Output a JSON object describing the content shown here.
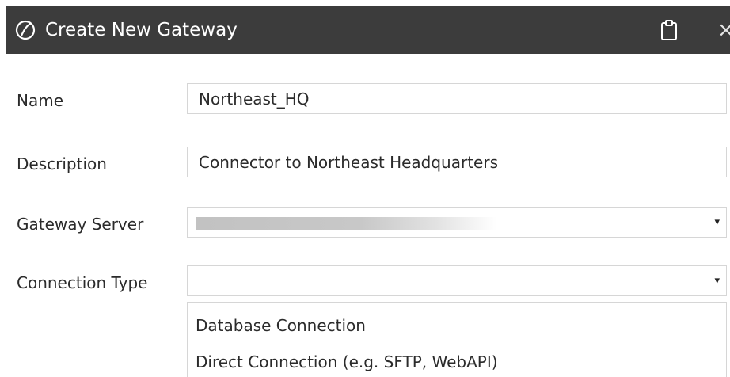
{
  "dialog": {
    "title": "Create New Gateway",
    "logo_icon": "circle-slash-logo-icon",
    "clipboard_icon": "clipboard-icon",
    "close_label": "×"
  },
  "form": {
    "name": {
      "label": "Name",
      "value": "Northeast_HQ"
    },
    "description": {
      "label": "Description",
      "value": "Connector to Northeast Headquarters"
    },
    "gateway_server": {
      "label": "Gateway Server",
      "value_redacted": true,
      "arrow": "▾"
    },
    "connection_type": {
      "label": "Connection Type",
      "value": "",
      "arrow": "▾",
      "options": [
        "Database Connection",
        "Direct Connection (e.g. SFTP, WebAPI)"
      ]
    }
  },
  "colors": {
    "titlebar": "#3c3c3c",
    "border": "#d6d6d6",
    "text": "#2b2b2b"
  }
}
